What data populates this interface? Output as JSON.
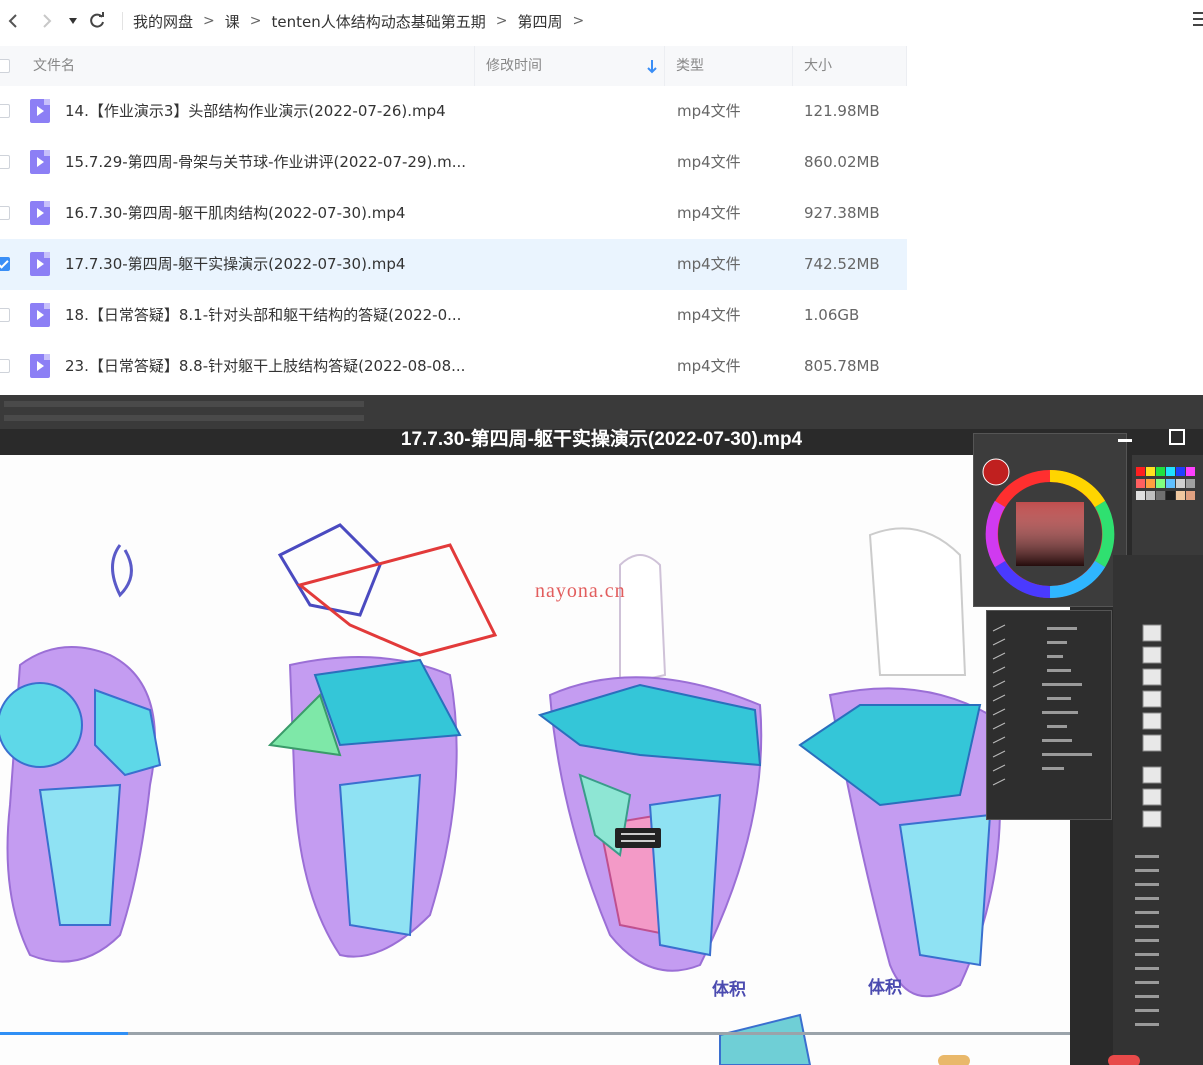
{
  "nav": {
    "back_icon": "chevron-left-icon",
    "forward_icon": "chevron-right-icon",
    "dropdown_icon": "caret-down-icon",
    "refresh_icon": "refresh-icon",
    "breadcrumbs": [
      "我的网盘",
      "课",
      "tenten人体结构动态基础第五期",
      "第四周"
    ],
    "breadcrumb_sep": ">"
  },
  "list": {
    "headers": {
      "name": "文件名",
      "modified": "修改时间",
      "type": "类型",
      "size": "大小"
    },
    "sort_icon": "arrow-down-icon",
    "rows": [
      {
        "name": "14.【作业演示3】头部结构作业演示(2022-07-26).mp4",
        "type": "mp4文件",
        "size": "121.98MB",
        "checked": false
      },
      {
        "name": "15.7.29-第四周-骨架与关节球-作业讲评(2022-07-29).m...",
        "type": "mp4文件",
        "size": "860.02MB",
        "checked": false
      },
      {
        "name": "16.7.30-第四周-躯干肌肉结构(2022-07-30).mp4",
        "type": "mp4文件",
        "size": "927.38MB",
        "checked": false
      },
      {
        "name": "17.7.30-第四周-躯干实操演示(2022-07-30).mp4",
        "type": "mp4文件",
        "size": "742.52MB",
        "checked": true
      },
      {
        "name": "18.【日常答疑】8.1-针对头部和躯干结构的答疑(2022-0...",
        "type": "mp4文件",
        "size": "1.06GB",
        "checked": false
      },
      {
        "name": "23.【日常答疑】8.8-针对躯干上肢结构答疑(2022-08-08...",
        "type": "mp4文件",
        "size": "805.78MB",
        "checked": false
      }
    ]
  },
  "player": {
    "title": "17.7.30-第四周-躯干实操演示(2022-07-30).mp4",
    "watermark": "nayona.cn",
    "canvas_labels": [
      "体积",
      "体积"
    ],
    "progress": 0.12,
    "colors": {
      "accent": "#3a8ef6",
      "file_icon": "#8c7ff5",
      "selected_row": "#eaf4fe",
      "progress": "#2f8ff5"
    }
  }
}
